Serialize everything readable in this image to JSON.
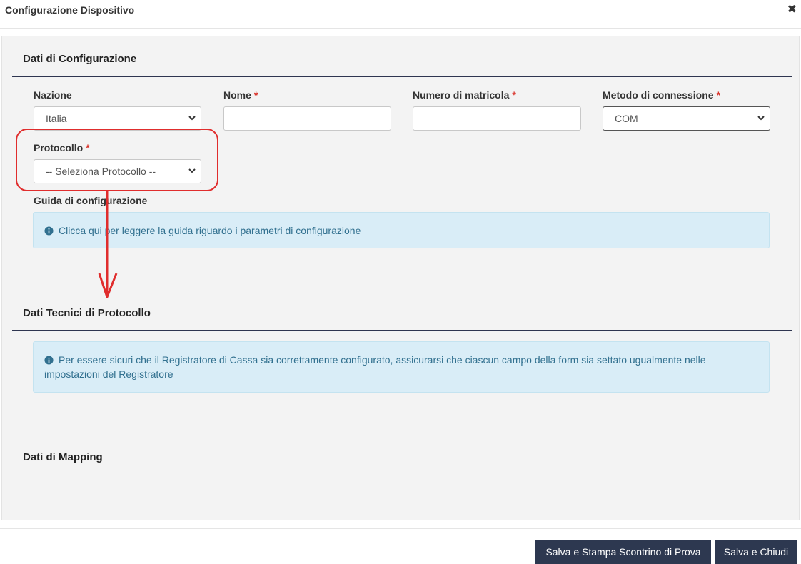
{
  "modal": {
    "title": "Configurazione Dispositivo"
  },
  "sections": {
    "config": {
      "title": "Dati di Configurazione"
    },
    "tech": {
      "title": "Dati Tecnici di Protocollo"
    },
    "mapping": {
      "title": "Dati di Mapping"
    }
  },
  "fields": {
    "nazione": {
      "label": "Nazione",
      "value": "Italia"
    },
    "nome": {
      "label": "Nome",
      "value": ""
    },
    "matricola": {
      "label": "Numero di matricola",
      "value": ""
    },
    "metodo": {
      "label": "Metodo di connessione",
      "value": "COM"
    },
    "protocollo": {
      "label": "Protocollo",
      "value": "-- Seleziona Protocollo --"
    },
    "required_marker": "*"
  },
  "guide": {
    "label": "Guida di configurazione",
    "text": "Clicca qui per leggere la guida riguardo i parametri di configurazione"
  },
  "tech_info": {
    "text": "Per essere sicuri che il Registratore di Cassa sia correttamente configurato, assicurarsi che ciascun campo della form sia settato ugualmente nelle impostazioni del Registratore"
  },
  "footer": {
    "print_button": "Salva e Stampa Scontrino di Prova",
    "save_button": "Salva e Chiudi"
  },
  "icons": {
    "close": "close-icon",
    "info": "info-circle-icon",
    "dropdown": "chevron-down-icon"
  },
  "colors": {
    "primary_button": "#2d3850",
    "required": "#d9332b",
    "info_bg": "#d9edf7",
    "info_text": "#31708f",
    "annotation": "#e02d2d"
  }
}
